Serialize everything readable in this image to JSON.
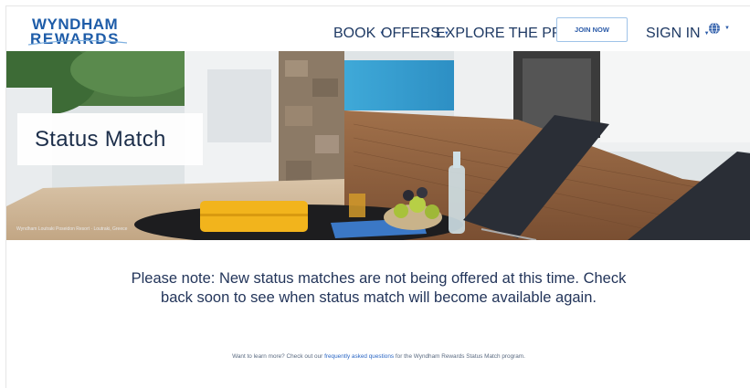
{
  "header": {
    "logo_top": "WYNDHAM",
    "logo_bottom": "REWARDS",
    "nav": [
      {
        "label": "BOOK"
      },
      {
        "label": "OFFERS"
      },
      {
        "label": "EXPLORE THE PROGRAM"
      }
    ],
    "join_label": "JOIN NOW",
    "signin_label": "SIGN IN",
    "globe_icon": "globe-icon"
  },
  "hero": {
    "title": "Status Match",
    "caption": "Wyndham Loutraki Poseidon Resort · Loutraki, Greece"
  },
  "main": {
    "notice": "Please note: New status matches are not being offered at this time. Check back soon to see when status match will become available again.",
    "learn_prefix": "Want to learn more? Check out our ",
    "learn_link": "frequently asked questions",
    "learn_suffix": " for the Wyndham Rewards Status Match program."
  },
  "colors": {
    "brand": "#1e5ca8",
    "nav": "#2a5aa8",
    "text": "#23355a"
  }
}
